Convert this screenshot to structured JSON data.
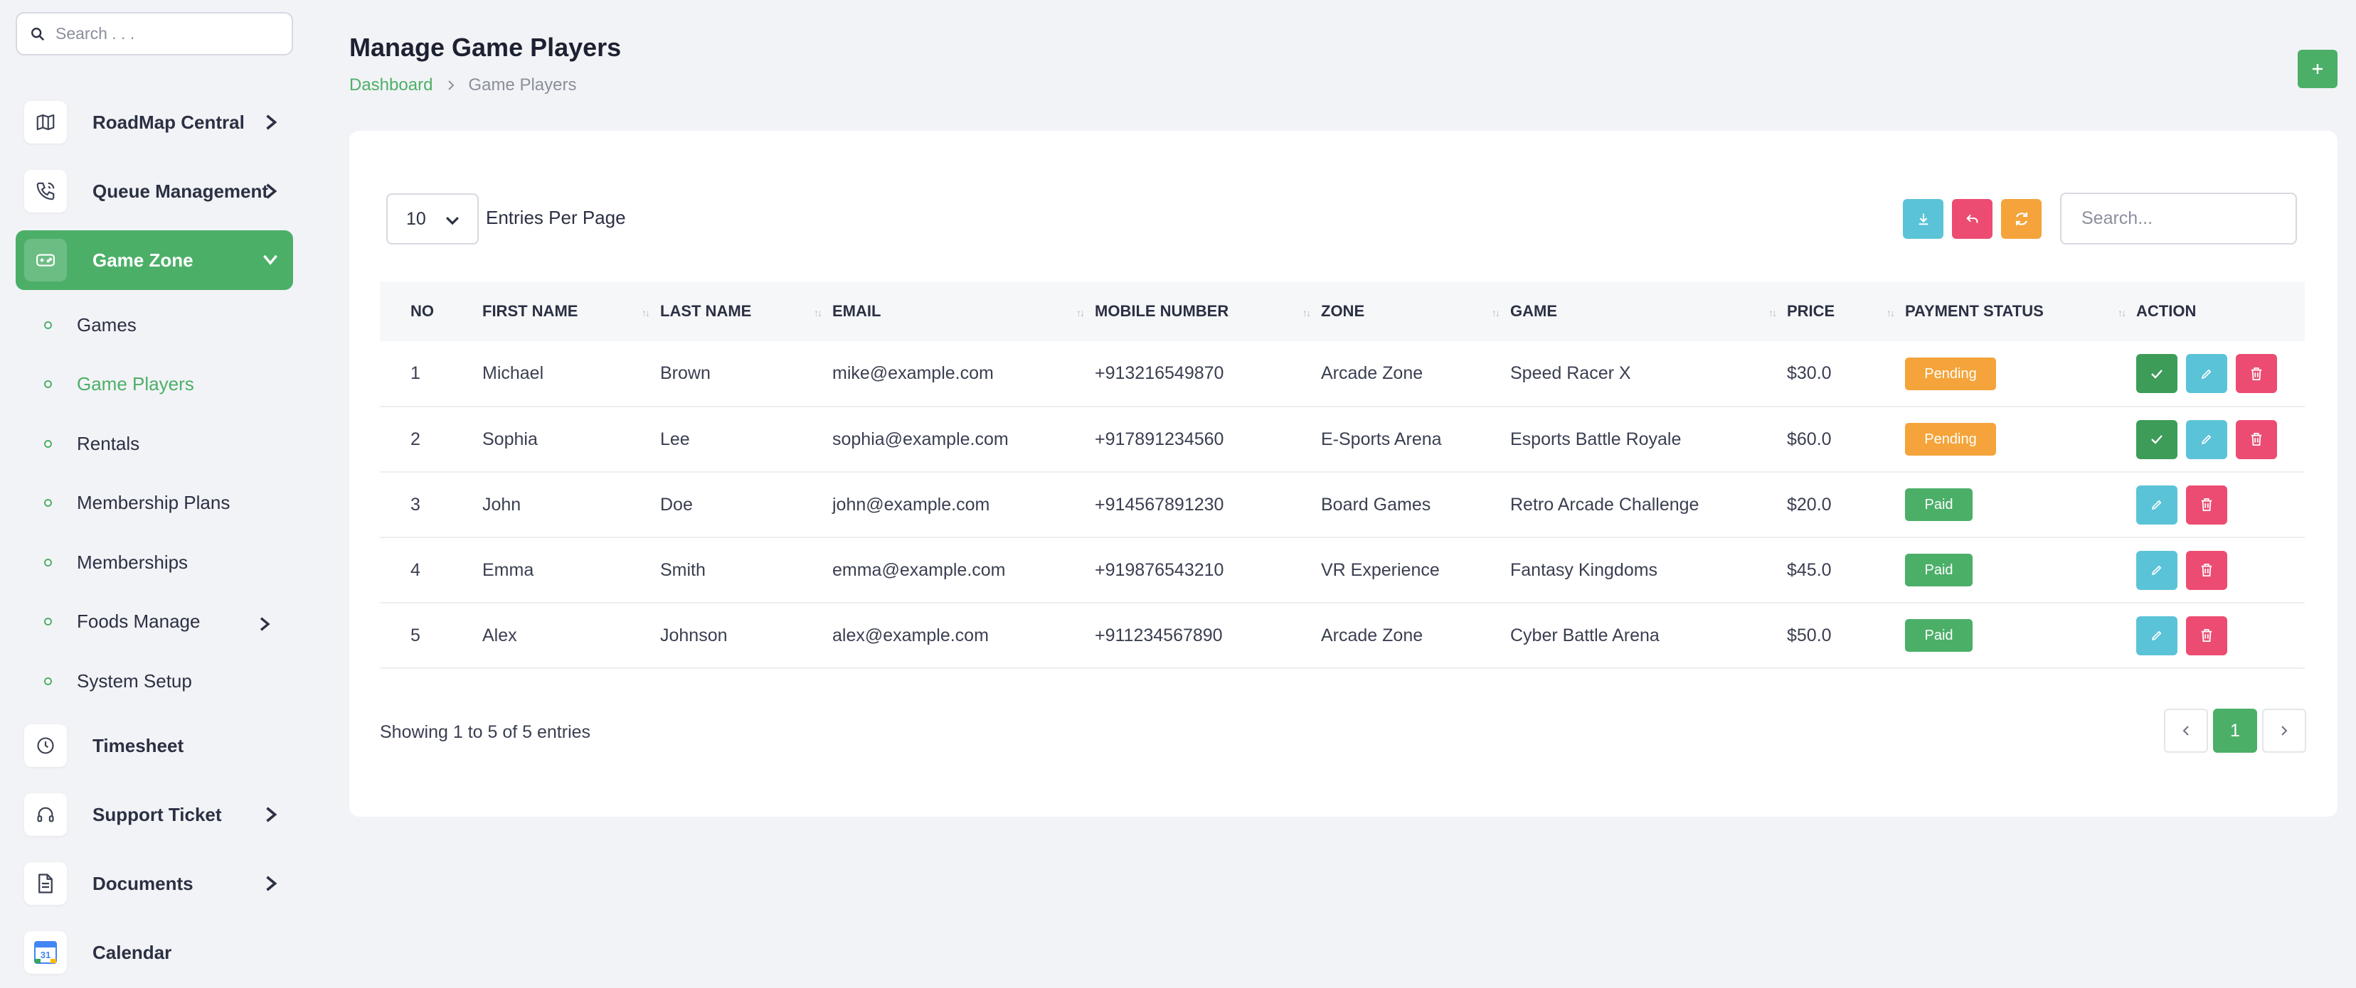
{
  "sidebar": {
    "search_placeholder": "Search . . .",
    "items": [
      {
        "label": "RoadMap Central",
        "icon": "map-icon"
      },
      {
        "label": "Queue Management",
        "icon": "phone-icon"
      },
      {
        "label": "Game Zone",
        "icon": "gamepad-icon"
      },
      {
        "label": "Timesheet",
        "icon": "clock-icon"
      },
      {
        "label": "Support Ticket",
        "icon": "headset-icon"
      },
      {
        "label": "Documents",
        "icon": "document-icon"
      },
      {
        "label": "Calendar",
        "icon": "calendar-icon",
        "calendar_day": "31"
      }
    ],
    "sub_items": [
      {
        "label": "Games"
      },
      {
        "label": "Game Players"
      },
      {
        "label": "Rentals"
      },
      {
        "label": "Membership Plans"
      },
      {
        "label": "Memberships"
      },
      {
        "label": "Foods Manage"
      },
      {
        "label": "System Setup"
      }
    ]
  },
  "header": {
    "title": "Manage Game Players",
    "breadcrumb": {
      "home": "Dashboard",
      "current": "Game Players"
    },
    "add_label": "+"
  },
  "table_controls": {
    "entries_value": "10",
    "entries_label": "Entries Per Page",
    "search_placeholder": "Search..."
  },
  "table": {
    "columns": [
      "NO",
      "FIRST NAME",
      "LAST NAME",
      "EMAIL",
      "MOBILE NUMBER",
      "ZONE",
      "GAME",
      "PRICE",
      "PAYMENT STATUS",
      "ACTION"
    ],
    "rows": [
      {
        "no": "1",
        "first": "Michael",
        "last": "Brown",
        "email": "mike@example.com",
        "mobile": "+913216549870",
        "zone": "Arcade Zone",
        "game": "Speed Racer X",
        "price": "$30.0",
        "status": "Pending"
      },
      {
        "no": "2",
        "first": "Sophia",
        "last": "Lee",
        "email": "sophia@example.com",
        "mobile": "+917891234560",
        "zone": "E-Sports Arena",
        "game": "Esports Battle Royale",
        "price": "$60.0",
        "status": "Pending"
      },
      {
        "no": "3",
        "first": "John",
        "last": "Doe",
        "email": "john@example.com",
        "mobile": "+914567891230",
        "zone": "Board Games",
        "game": "Retro Arcade Challenge",
        "price": "$20.0",
        "status": "Paid"
      },
      {
        "no": "4",
        "first": "Emma",
        "last": "Smith",
        "email": "emma@example.com",
        "mobile": "+919876543210",
        "zone": "VR Experience",
        "game": "Fantasy Kingdoms",
        "price": "$45.0",
        "status": "Paid"
      },
      {
        "no": "5",
        "first": "Alex",
        "last": "Johnson",
        "email": "alex@example.com",
        "mobile": "+911234567890",
        "zone": "Arcade Zone",
        "game": "Cyber Battle Arena",
        "price": "$50.0",
        "status": "Paid"
      }
    ]
  },
  "footer": {
    "info": "Showing 1 to 5 of 5 entries",
    "current_page": "1"
  },
  "colors": {
    "accent": "#4caf68",
    "pending": "#f4a43a",
    "edit": "#5bc3d8",
    "delete": "#ec4c72",
    "approve": "#3d9c58"
  }
}
